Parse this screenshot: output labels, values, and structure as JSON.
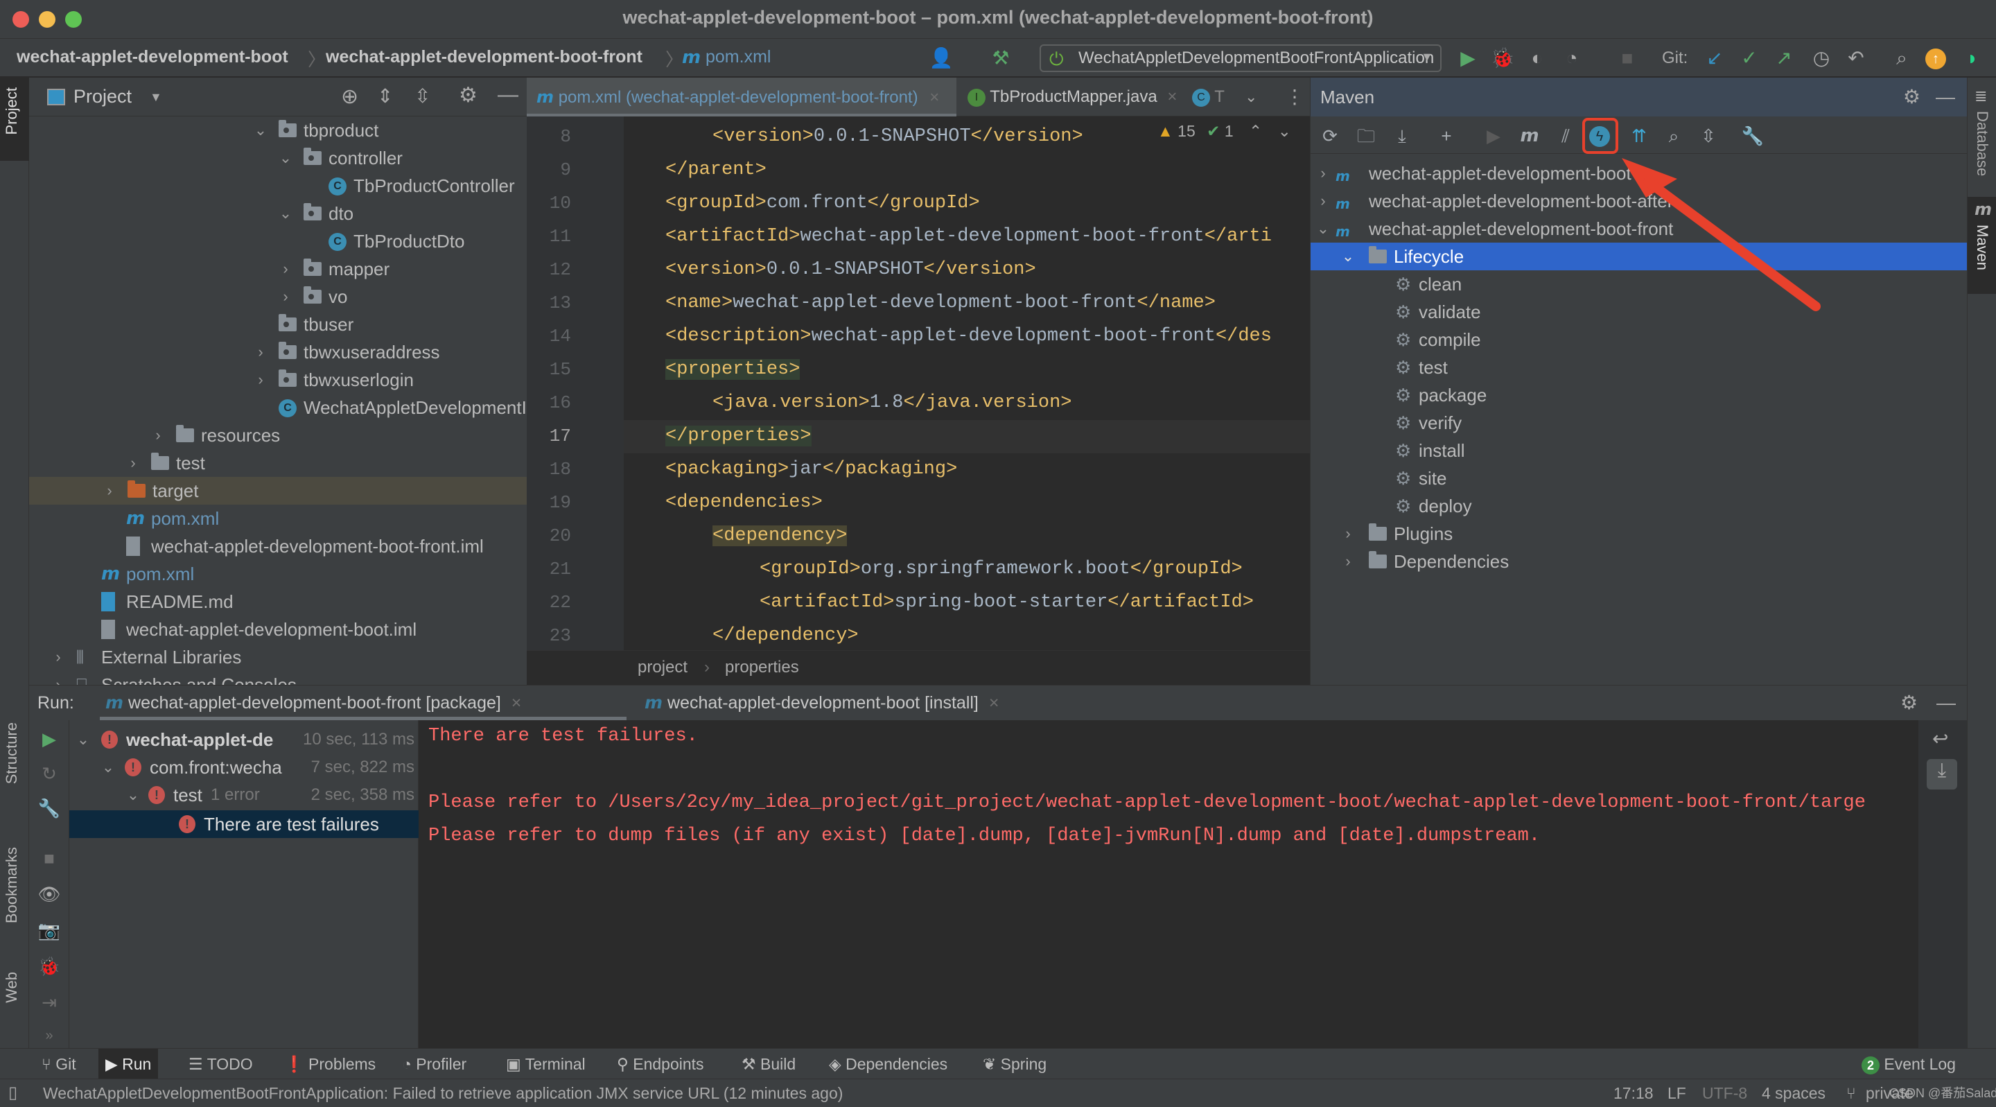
{
  "window": {
    "title": "wechat-applet-development-boot – pom.xml (wechat-applet-development-boot-front)"
  },
  "navbar": {
    "breadcrumbs": [
      "wechat-applet-development-boot",
      "wechat-applet-development-boot-front",
      "pom.xml"
    ],
    "run_config": "WechatAppletDevelopmentBootFrontApplication",
    "git_label": "Git:"
  },
  "project_panel": {
    "title": "Project",
    "vertical_tab": "Project",
    "tree": [
      {
        "label": "tbproduct",
        "type": "package",
        "expanded": true
      },
      {
        "label": "controller",
        "type": "package",
        "expanded": true
      },
      {
        "label": "TbProductController",
        "type": "class"
      },
      {
        "label": "dto",
        "type": "package",
        "expanded": true
      },
      {
        "label": "TbProductDto",
        "type": "class"
      },
      {
        "label": "mapper",
        "type": "package",
        "expanded": false
      },
      {
        "label": "vo",
        "type": "package",
        "expanded": false
      },
      {
        "label": "tbuser",
        "type": "package"
      },
      {
        "label": "tbwxuseraddress",
        "type": "package",
        "expanded": false
      },
      {
        "label": "tbwxuserlogin",
        "type": "package",
        "expanded": false
      },
      {
        "label": "WechatAppletDevelopmentI",
        "type": "spring-class"
      },
      {
        "label": "resources",
        "type": "resources-folder",
        "expanded": false
      },
      {
        "label": "test",
        "type": "folder",
        "expanded": false
      },
      {
        "label": "target",
        "type": "excluded-folder",
        "expanded": false
      },
      {
        "label": "pom.xml",
        "type": "maven"
      },
      {
        "label": "wechat-applet-development-boot-front.iml",
        "type": "iml"
      },
      {
        "label": "pom.xml",
        "type": "maven"
      },
      {
        "label": "README.md",
        "type": "markdown"
      },
      {
        "label": "wechat-applet-development-boot.iml",
        "type": "iml"
      },
      {
        "label": "External Libraries",
        "type": "libraries",
        "expanded": false
      },
      {
        "label": "Scratches and Consoles",
        "type": "scratches",
        "expanded": false
      }
    ]
  },
  "editor": {
    "tabs": [
      {
        "label": "pom.xml (wechat-applet-development-boot-front)",
        "icon": "maven-icon",
        "active": true
      },
      {
        "label": "TbProductMapper.java",
        "icon": "interface-icon",
        "active": false
      },
      {
        "label": "T",
        "icon": "class-icon",
        "active": false
      }
    ],
    "inspections": {
      "warnings": "15",
      "typos": "1"
    },
    "lines": [
      {
        "num": "8",
        "indent": 2,
        "open": "<version>",
        "text": "0.0.1-SNAPSHOT",
        "close": "</version>"
      },
      {
        "num": "9",
        "indent": 1,
        "open": "",
        "text": "",
        "close": "</parent>"
      },
      {
        "num": "10",
        "indent": 1,
        "open": "<groupId>",
        "text": "com.front",
        "close": "</groupId>"
      },
      {
        "num": "11",
        "indent": 1,
        "open": "<artifactId>",
        "text": "wechat-applet-development-boot-front",
        "close": "</arti"
      },
      {
        "num": "12",
        "indent": 1,
        "open": "<version>",
        "text": "0.0.1-SNAPSHOT",
        "close": "</version>"
      },
      {
        "num": "13",
        "indent": 1,
        "open": "<name>",
        "text": "wechat-applet-development-boot-front",
        "close": "</name>"
      },
      {
        "num": "14",
        "indent": 1,
        "open": "<description>",
        "text": "wechat-applet-development-boot-front",
        "close": "</des"
      },
      {
        "num": "15",
        "indent": 1,
        "open": "<properties>",
        "text": "",
        "close": ""
      },
      {
        "num": "16",
        "indent": 2,
        "open": "<java.version>",
        "text": "1.8",
        "close": "</java.version>"
      },
      {
        "num": "17",
        "indent": 1,
        "open": "",
        "text": "",
        "close": "</properties>"
      },
      {
        "num": "18",
        "indent": 1,
        "open": "<packaging>",
        "text": "jar",
        "close": "</packaging>"
      },
      {
        "num": "19",
        "indent": 1,
        "open": "<dependencies>",
        "text": "",
        "close": ""
      },
      {
        "num": "20",
        "indent": 2,
        "open": "<dependency>",
        "text": "",
        "close": ""
      },
      {
        "num": "21",
        "indent": 3,
        "open": "<groupId>",
        "text": "org.springframework.boot",
        "close": "</groupId>"
      },
      {
        "num": "22",
        "indent": 3,
        "open": "<artifactId>",
        "text": "spring-boot-starter",
        "close": "</artifactId>"
      },
      {
        "num": "23",
        "indent": 2,
        "open": "",
        "text": "",
        "close": "</dependency>"
      }
    ],
    "breadcrumb": [
      "project",
      "properties"
    ]
  },
  "maven": {
    "title": "Maven",
    "vertical_tab": "Maven",
    "toolbar": [
      "reload-icon",
      "generate-sources-icon",
      "download-icon",
      "add-icon",
      "run-icon",
      "execute-goal-icon",
      "toggle-offline-icon",
      "skip-tests-icon",
      "show-dependencies-icon",
      "find-icon",
      "collapse-all-icon",
      "settings-wrench-icon"
    ],
    "projects": [
      {
        "label": "wechat-applet-development-boot",
        "expanded": false
      },
      {
        "label": "wechat-applet-development-boot-after",
        "expanded": false
      },
      {
        "label": "wechat-applet-development-boot-front",
        "expanded": true
      }
    ],
    "lifecycle_label": "Lifecycle",
    "lifecycle": [
      "clean",
      "validate",
      "compile",
      "test",
      "package",
      "verify",
      "install",
      "site",
      "deploy"
    ],
    "plugins_label": "Plugins",
    "dependencies_label": "Dependencies",
    "highlight_color": "#e8412c"
  },
  "right_strip": {
    "database": "Database",
    "maven": "Maven"
  },
  "left_strip": {
    "structure": "Structure",
    "bookmarks": "Bookmarks",
    "web": "Web"
  },
  "run_panel": {
    "label": "Run:",
    "tabs": [
      {
        "label": "wechat-applet-development-boot-front [package]",
        "active": true
      },
      {
        "label": "wechat-applet-development-boot [install]",
        "active": false
      }
    ],
    "tree": [
      {
        "label": "wechat-applet-de",
        "duration": "10 sec, 113 ms",
        "bold": true
      },
      {
        "label": "com.front:wecha",
        "duration": "7 sec, 822 ms"
      },
      {
        "label": "test",
        "note": "1 error",
        "duration": "2 sec, 358 ms"
      },
      {
        "label": "There are test failures",
        "selected": true
      }
    ],
    "console": [
      "There are test failures.",
      "",
      "Please refer to /Users/2cy/my_idea_project/git_project/wechat-applet-development-boot/wechat-applet-development-boot-front/targe",
      "Please refer to dump files (if any exist) [date].dump, [date]-jvmRun[N].dump and [date].dumpstream."
    ]
  },
  "bottom_toolbar": {
    "items": [
      "Git",
      "Run",
      "TODO",
      "Problems",
      "Profiler",
      "Terminal",
      "Endpoints",
      "Build",
      "Dependencies",
      "Spring"
    ],
    "event_log": "Event Log",
    "event_count": "2"
  },
  "status_bar": {
    "message": "WechatAppletDevelopmentBootFrontApplication: Failed to retrieve application JMX service URL (12 minutes ago)",
    "position": "17:18",
    "line_sep": "LF",
    "encoding": "UTF-8",
    "indent": "4 spaces",
    "branch": "private",
    "watermark": "CSDN @番茄Salad"
  }
}
